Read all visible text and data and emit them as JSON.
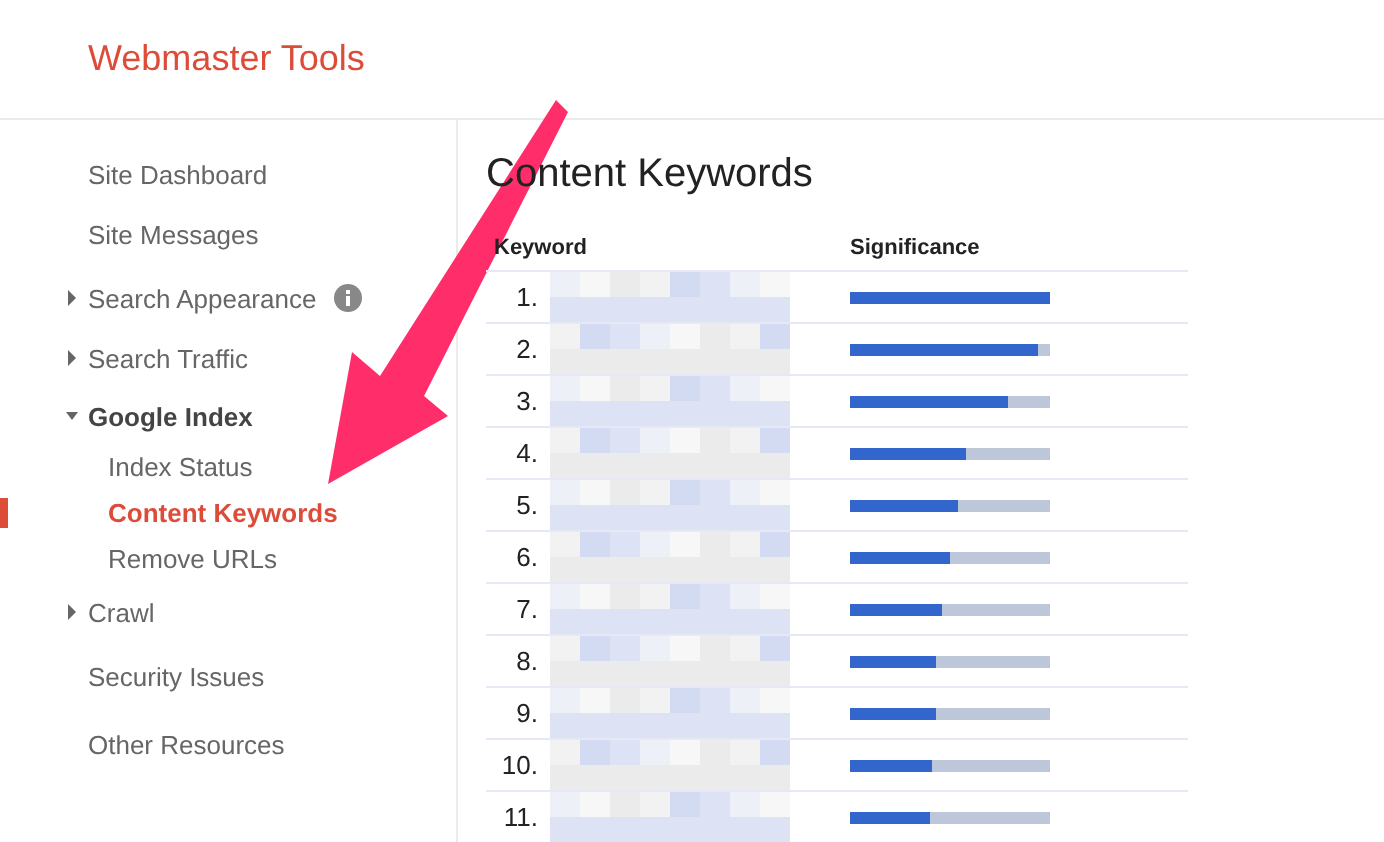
{
  "header": {
    "title": "Webmaster Tools"
  },
  "sidebar": {
    "items": [
      {
        "kind": "link",
        "label": "Site Dashboard"
      },
      {
        "kind": "link",
        "label": "Site Messages"
      },
      {
        "kind": "group",
        "label": "Search Appearance",
        "expanded": false,
        "info": true
      },
      {
        "kind": "group",
        "label": "Search Traffic",
        "expanded": false
      },
      {
        "kind": "group",
        "label": "Google Index",
        "expanded": true,
        "children": [
          {
            "label": "Index Status",
            "selected": false
          },
          {
            "label": "Content Keywords",
            "selected": true
          },
          {
            "label": "Remove URLs",
            "selected": false
          }
        ]
      },
      {
        "kind": "group",
        "label": "Crawl",
        "expanded": false
      },
      {
        "kind": "link",
        "label": "Security Issues"
      },
      {
        "kind": "link",
        "label": "Other Resources"
      }
    ]
  },
  "main": {
    "heading": "Content Keywords",
    "table": {
      "columns": [
        "Keyword",
        "Significance"
      ],
      "rows": [
        {
          "rank": "1.",
          "level": 1
        },
        {
          "rank": "2.",
          "level": 0.94
        },
        {
          "rank": "3.",
          "level": 0.79
        },
        {
          "rank": "4.",
          "level": 0.58
        },
        {
          "rank": "5.",
          "level": 0.54
        },
        {
          "rank": "6.",
          "level": 0.5
        },
        {
          "rank": "7.",
          "level": 0.46
        },
        {
          "rank": "8.",
          "level": 0.43
        },
        {
          "rank": "9.",
          "level": 0.43
        },
        {
          "rank": "10.",
          "level": 0.41
        },
        {
          "rank": "11.",
          "level": 0.4
        }
      ]
    }
  }
}
